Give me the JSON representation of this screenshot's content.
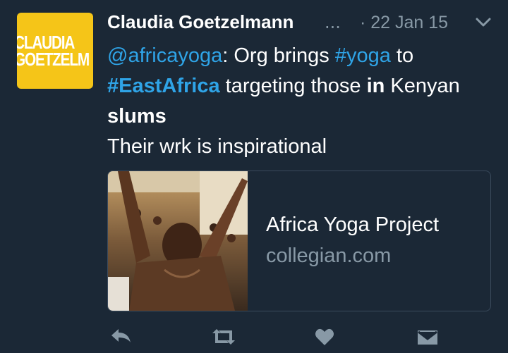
{
  "author": {
    "name": "Claudia Goetzelmann",
    "avatar_text_line1": "CLAUDIA",
    "avatar_text_line2": "GOETZELM",
    "ellipsis": "..."
  },
  "tweet": {
    "date": "· 22 Jan 15",
    "mention": "@africayoga",
    "t1": ": Org brings ",
    "hashtag1": "#yoga",
    "t2": " to",
    "hashtag2": "#EastAfrica",
    "t3": " targeting those ",
    "bold1": "in",
    "t4": " Kenyan",
    "bold2": "slums",
    "line4": "Their wrk is inspirational"
  },
  "card": {
    "title": "Africa Yoga Project",
    "domain": "collegian.com"
  },
  "icons": {
    "reply": "reply-icon",
    "retweet": "retweet-icon",
    "like": "heart-icon",
    "dm": "envelope-icon",
    "more": "chevron-down-icon"
  },
  "colors": {
    "background": "#1b2836",
    "link": "#2fa4e7",
    "muted": "#8899a6",
    "avatar": "#f5c518"
  }
}
